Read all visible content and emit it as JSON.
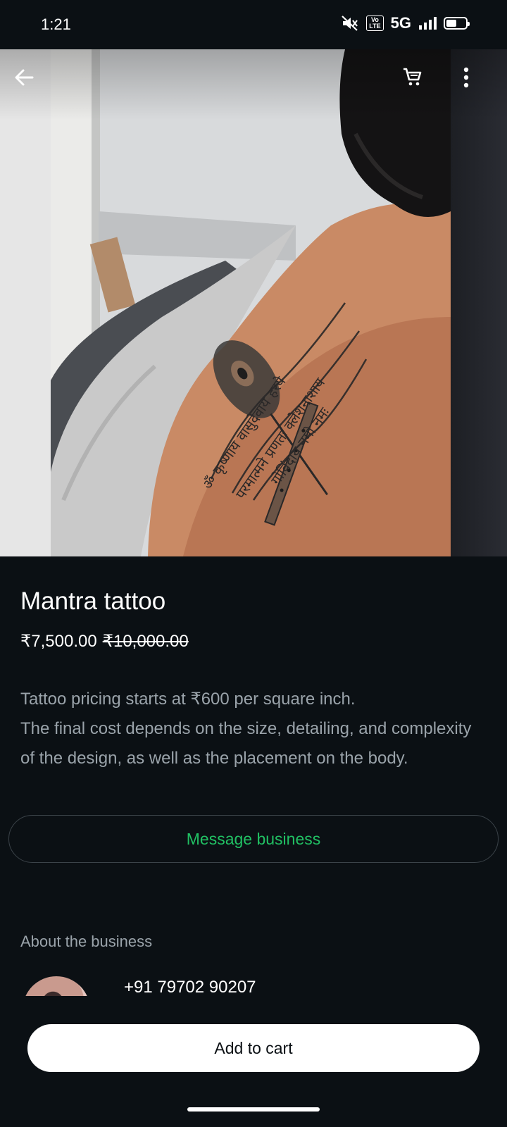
{
  "status_bar": {
    "time": "1:21",
    "volte": "Vo\nLTE",
    "network": "5G",
    "icons": [
      "mute-icon",
      "volte-icon",
      "signal-icon",
      "battery-icon"
    ]
  },
  "header": {
    "back_icon": "arrow-left-icon",
    "cart_icon": "cart-icon",
    "menu_icon": "more-vertical-icon"
  },
  "product": {
    "title": "Mantra tattoo",
    "price": "₹7,500.00",
    "original_price": "₹10,000.00",
    "description": "Tattoo pricing starts at ₹600 per square inch.\nThe final cost depends on the size, detailing, and complexity of the design, as well as the placement on the body."
  },
  "actions": {
    "message_label": "Message business",
    "add_to_cart_label": "Add to cart"
  },
  "business": {
    "section_label": "About the business",
    "phone": "+91 79702 90207"
  },
  "colors": {
    "background": "#0b1014",
    "accent_green": "#21c063",
    "muted_text": "#9aa3aa"
  }
}
